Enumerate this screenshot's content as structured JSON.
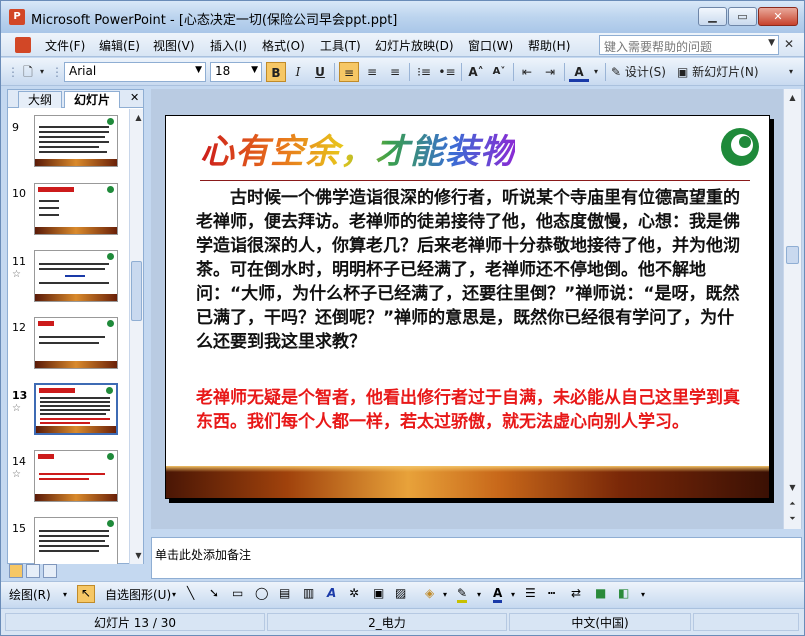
{
  "window": {
    "title": "Microsoft PowerPoint - [心态决定一切(保险公司早会ppt.ppt]",
    "app_icon_letter": "P"
  },
  "menu": {
    "items": [
      "文件(F)",
      "编辑(E)",
      "视图(V)",
      "插入(I)",
      "格式(O)",
      "工具(T)",
      "幻灯片放映(D)",
      "窗口(W)",
      "帮助(H)"
    ],
    "help_placeholder": "键入需要帮助的问题"
  },
  "toolbar": {
    "font_name": "Arial",
    "font_size": "18",
    "bold": "B",
    "italic": "I",
    "underline": "U",
    "design_label": "设计(S)",
    "new_slide_label": "新幻灯片(N)"
  },
  "left_pane": {
    "tab_outline": "大纲",
    "tab_slides": "幻灯片",
    "slide_numbers": [
      "9",
      "10",
      "11",
      "12",
      "13",
      "14",
      "15"
    ],
    "selected_slide": "13"
  },
  "slide": {
    "title": "心有空余，才能装物",
    "body": "古时候一个佛学造诣很深的修行者，听说某个寺庙里有位德高望重的老禅师，便去拜访。老禅师的徒弟接待了他，他态度傲慢，心想：我是佛学造诣很深的人，你算老几？后来老禅师十分恭敬地接待了他，并为他沏茶。可在倒水时，明明杯子已经满了，老禅师还不停地倒。他不解地问：“大师，为什么杯子已经满了，还要往里倒？”禅师说：“是呀，既然已满了，干吗？还倒呢？”禅师的意思是，既然你已经很有学问了，为什么还要到我这里求教？",
    "conclusion": "老禅师无疑是个智者，他看出修行者过于自满，未必能从自己这里学到真东西。我们每个人都一样，若太过骄傲，就无法虚心向别人学习。"
  },
  "notes": {
    "placeholder": "单击此处添加备注"
  },
  "drawbar": {
    "draw_label": "绘图(R)",
    "autoshapes_label": "自选图形(U)"
  },
  "status": {
    "slide_counter": "幻灯片 13 / 30",
    "design": "2_电力",
    "language": "中文(中国)"
  },
  "colors": {
    "title_bar": "#bcd4ee",
    "accent_red": "#e81818",
    "selection": "#3e6bb4"
  }
}
